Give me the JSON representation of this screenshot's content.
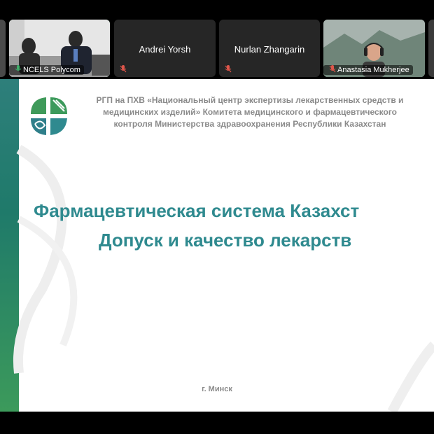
{
  "participants": [
    {
      "name": "NCELS Polycom",
      "muted": false,
      "video": true
    },
    {
      "name": "Andrei Yorsh",
      "muted": true,
      "video": false
    },
    {
      "name": "Nurlan Zhangarin",
      "muted": true,
      "video": false
    },
    {
      "name": "Anastasia Mukherjee",
      "muted": true,
      "video": true
    }
  ],
  "slide": {
    "header": "РГП на ПХВ «Национальный центр экспертизы лекарственных средств и медицинских изделий» Комитета медицинского и фармацевтического контроля Министерства здравоохранения Республики Казахстан",
    "title_line1": "Фармацевтическая система Казахст",
    "title_line2": "Допуск и качество лекарств",
    "city": "г. Минск"
  },
  "colors": {
    "accent_green": "#3fae6a",
    "title_teal": "#2f8a8f",
    "muted_red": "#e0564b"
  },
  "icons": [
    "mic-on-icon",
    "mic-muted-icon",
    "logo"
  ]
}
